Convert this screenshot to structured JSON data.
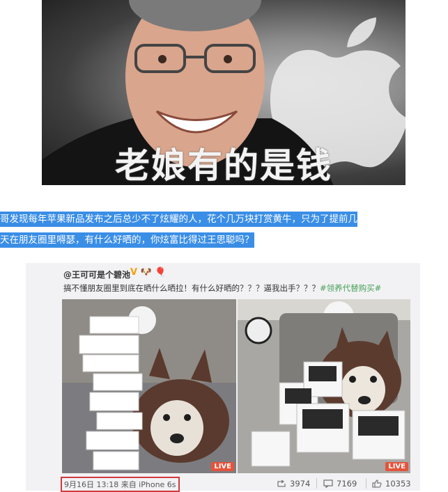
{
  "meme": {
    "caption": "老娘有的是钱"
  },
  "article": {
    "line1": "  哥发现每年苹果新品发布之后总少不了炫耀的人，花个几万块打赏黄牛，只为了提前几",
    "line2": "天在朋友圈里嘚瑟，有什么好晒的，你炫富比得过王思聪吗？"
  },
  "weibo": {
    "username": "@王可可是个碧池",
    "badges": "V 🐶 🎈",
    "text": "搞不懂朋友圈里到底在晒什么晒拉！有什么好晒的？？？逼我出手？？？",
    "hashtag": "#领养代替购买#",
    "photo1_live": "LIVE",
    "photo2_live": "LIVE",
    "timestamp": "9月16日 13:18 来自 iPhone 6s",
    "reposts": "3974",
    "comments": "7169",
    "likes": "10353"
  },
  "colors": {
    "highlight": "#3a8ee6",
    "hashtag": "#49a05a",
    "live_badge": "#e5533b",
    "timestamp_box": "#d03a3a"
  },
  "icons": [
    "apple-logo-icon",
    "repost-icon",
    "comment-icon",
    "like-icon"
  ]
}
